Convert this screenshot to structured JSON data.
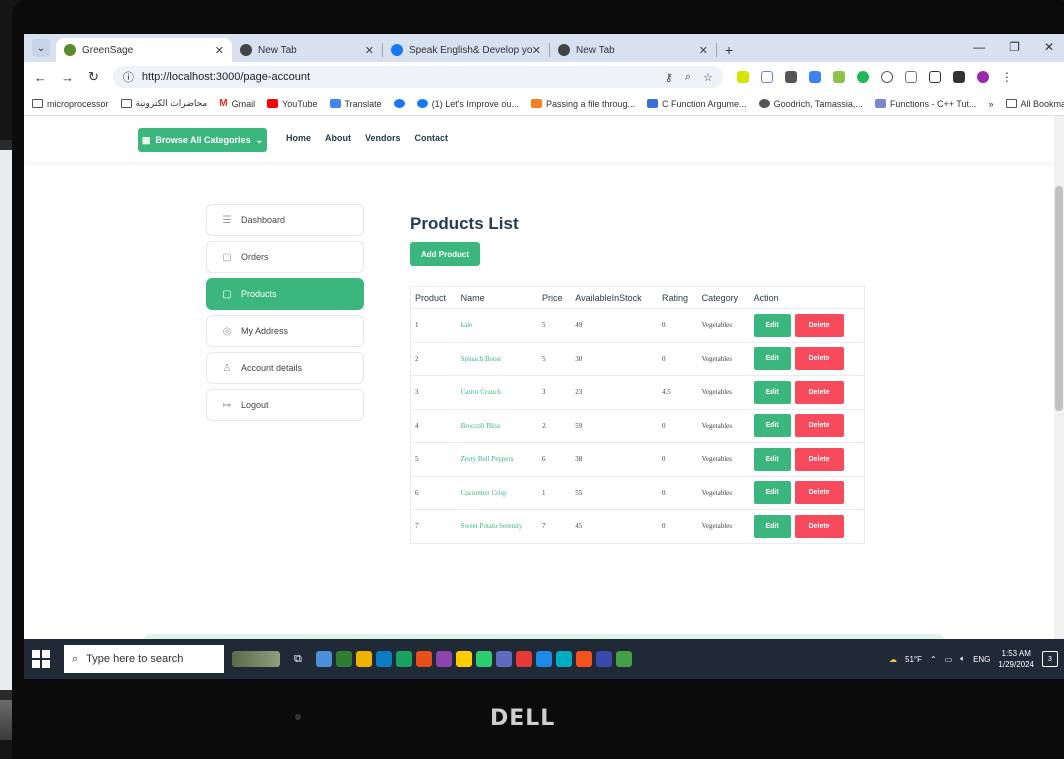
{
  "browser": {
    "tabs": [
      {
        "title": "GreenSage",
        "active": true,
        "favicon_color": "#5b8a2b"
      },
      {
        "title": "New Tab",
        "active": false,
        "favicon_color": "#444444"
      },
      {
        "title": "Speak English& Develop your ",
        "active": false,
        "favicon_color": "#1877f2"
      },
      {
        "title": "New Tab",
        "active": false,
        "favicon_color": "#444444"
      }
    ],
    "new_tab_label": "+",
    "url": "http://localhost:3000/page-account",
    "bookmarks": [
      {
        "label": "microprocessor",
        "kind": "folder"
      },
      {
        "label": "محاضرات الكترونية",
        "kind": "folder"
      },
      {
        "label": "Gmail",
        "kind": "gmail"
      },
      {
        "label": "YouTube",
        "kind": "youtube"
      },
      {
        "label": "Translate",
        "kind": "translate"
      },
      {
        "label": "",
        "kind": "facebook"
      },
      {
        "label": "(1) Let's Improve ou...",
        "kind": "facebook"
      },
      {
        "label": "Passing a file throug...",
        "kind": "stackoverflow"
      },
      {
        "label": "C Function Argume...",
        "kind": "site"
      },
      {
        "label": "Goodrich, Tamassia,...",
        "kind": "site"
      },
      {
        "label": "Functions - C++ Tut...",
        "kind": "site"
      }
    ],
    "bookmarks_overflow": "»",
    "all_bookmarks": "All Bookmarks"
  },
  "site_nav": {
    "browse_label": "Browse All Categories",
    "links": [
      "Home",
      "About",
      "Vendors",
      "Contact"
    ]
  },
  "sidebar": {
    "items": [
      {
        "label": "Dashboard",
        "icon": "sliders-icon",
        "glyph": "☰",
        "active": false
      },
      {
        "label": "Orders",
        "icon": "bag-icon",
        "glyph": "▢",
        "active": false
      },
      {
        "label": "Products",
        "icon": "bag-icon",
        "glyph": "▢",
        "active": true
      },
      {
        "label": "My Address",
        "icon": "location-icon",
        "glyph": "◎",
        "active": false
      },
      {
        "label": "Account details",
        "icon": "user-icon",
        "glyph": "♙",
        "active": false
      },
      {
        "label": "Logout",
        "icon": "logout-icon",
        "glyph": "↦",
        "active": false
      }
    ]
  },
  "products": {
    "title": "Products List",
    "add_label": "Add Product",
    "columns": [
      "Product",
      "Name",
      "Price",
      "AvailableInStock",
      "Rating",
      "Category",
      "Action"
    ],
    "edit_label": "Edit",
    "delete_label": "Delete",
    "rows": [
      {
        "id": "1",
        "name": "kale",
        "price": "5",
        "stock": "49",
        "rating": "0",
        "category": "Vegetables"
      },
      {
        "id": "2",
        "name": "Spinach Boost",
        "price": "5",
        "stock": "30",
        "rating": "0",
        "category": "Vegetables"
      },
      {
        "id": "3",
        "name": "Carrot Crunch",
        "price": "3",
        "stock": "23",
        "rating": "4.5",
        "category": "Vegetables"
      },
      {
        "id": "4",
        "name": "Broccoli Bliss",
        "price": "2",
        "stock": "59",
        "rating": "0",
        "category": "Vegetables"
      },
      {
        "id": "5",
        "name": "Zesty Bell Peppers",
        "price": "6",
        "stock": "38",
        "rating": "0",
        "category": "Vegetables"
      },
      {
        "id": "6",
        "name": "Cucumber Crisp",
        "price": "1",
        "stock": "55",
        "rating": "0",
        "category": "Vegetables"
      },
      {
        "id": "7",
        "name": "Sweet Potato Serenity",
        "price": "7",
        "stock": "45",
        "rating": "0",
        "category": "Vegetables"
      }
    ]
  },
  "taskbar": {
    "search_placeholder": "Type here to search",
    "weather": "51°F",
    "language": "ENG",
    "time": "1:53 AM",
    "date": "1/29/2024",
    "notification_count": "3",
    "app_icon_colors": [
      "#4a90d9",
      "#2e7d32",
      "#f0b400",
      "#0a7cc1",
      "#1aa260",
      "#e94e1b",
      "#8e44ad",
      "#ffcc00",
      "#2ecc71",
      "#5c6bc0",
      "#e53935",
      "#1e88e5",
      "#00acc1",
      "#f4511e",
      "#3949ab",
      "#43a047"
    ]
  },
  "colors": {
    "brand_green": "#3bb77e",
    "delete_red": "#f74a5d",
    "heading": "#253d4e"
  },
  "device": {
    "brand": "DELL"
  }
}
